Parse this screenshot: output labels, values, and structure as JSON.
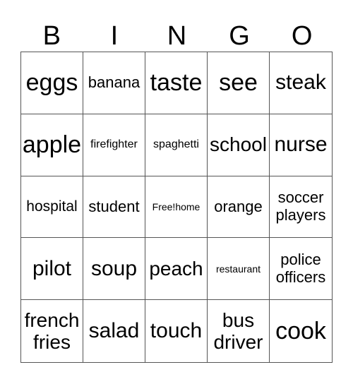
{
  "header": [
    "B",
    "I",
    "N",
    "G",
    "O"
  ],
  "cells": [
    [
      "eggs",
      "banana",
      "taste",
      "see",
      "steak"
    ],
    [
      "apple",
      "firefighter",
      "spaghetti",
      "school",
      "nurse"
    ],
    [
      "hospital",
      "student",
      "Free!home",
      "orange",
      "soccer players"
    ],
    [
      "pilot",
      "soup",
      "peach",
      "restaurant",
      "police officers"
    ],
    [
      "french fries",
      "salad",
      "touch",
      "bus driver",
      "cook"
    ]
  ]
}
